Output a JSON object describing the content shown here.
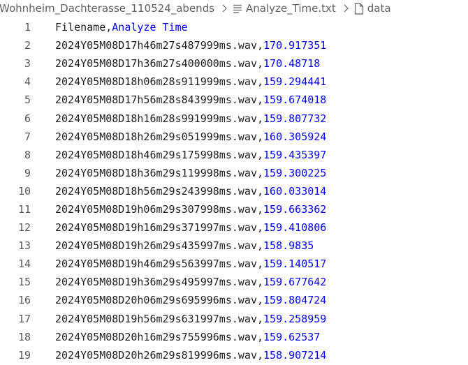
{
  "breadcrumb": {
    "folder": "Wohnheim_Dachterasse_110524_abends",
    "file": "Analyze_Time.txt",
    "symbol": "data",
    "separator_icon": "chevron-right-icon",
    "file_icon": "text-file-lines-icon",
    "symbol_icon": "document-icon"
  },
  "colors": {
    "text": "#1f1f1f",
    "value": "#0000ff",
    "line_number": "#5a5a5a",
    "breadcrumb": "#616161"
  },
  "lines": [
    {
      "num": "1",
      "name": "Filename,",
      "value": "Analyze Time"
    },
    {
      "num": "2",
      "name": "2024Y05M08D17h46m27s487999ms.wav,",
      "value": "170.917351"
    },
    {
      "num": "3",
      "name": "2024Y05M08D17h36m27s400000ms.wav,",
      "value": "170.48718"
    },
    {
      "num": "4",
      "name": "2024Y05M08D18h06m28s911999ms.wav,",
      "value": "159.294441"
    },
    {
      "num": "5",
      "name": "2024Y05M08D17h56m28s843999ms.wav,",
      "value": "159.674018"
    },
    {
      "num": "6",
      "name": "2024Y05M08D18h16m28s991999ms.wav,",
      "value": "159.807732"
    },
    {
      "num": "7",
      "name": "2024Y05M08D18h26m29s051999ms.wav,",
      "value": "160.305924"
    },
    {
      "num": "8",
      "name": "2024Y05M08D18h46m29s175998ms.wav,",
      "value": "159.435397"
    },
    {
      "num": "9",
      "name": "2024Y05M08D18h36m29s119998ms.wav,",
      "value": "159.300225"
    },
    {
      "num": "10",
      "name": "2024Y05M08D18h56m29s243998ms.wav,",
      "value": "160.033014"
    },
    {
      "num": "11",
      "name": "2024Y05M08D19h06m29s307998ms.wav,",
      "value": "159.663362"
    },
    {
      "num": "12",
      "name": "2024Y05M08D19h16m29s371997ms.wav,",
      "value": "159.410806"
    },
    {
      "num": "13",
      "name": "2024Y05M08D19h26m29s435997ms.wav,",
      "value": "158.9835"
    },
    {
      "num": "14",
      "name": "2024Y05M08D19h46m29s563997ms.wav,",
      "value": "159.140517"
    },
    {
      "num": "15",
      "name": "2024Y05M08D19h36m29s495997ms.wav,",
      "value": "159.677642"
    },
    {
      "num": "16",
      "name": "2024Y05M08D20h06m29s695996ms.wav,",
      "value": "159.804724"
    },
    {
      "num": "17",
      "name": "2024Y05M08D19h56m29s631997ms.wav,",
      "value": "159.258959"
    },
    {
      "num": "18",
      "name": "2024Y05M08D20h16m29s755996ms.wav,",
      "value": "159.62537"
    },
    {
      "num": "19",
      "name": "2024Y05M08D20h26m29s819996ms.wav,",
      "value": "158.907214"
    }
  ]
}
